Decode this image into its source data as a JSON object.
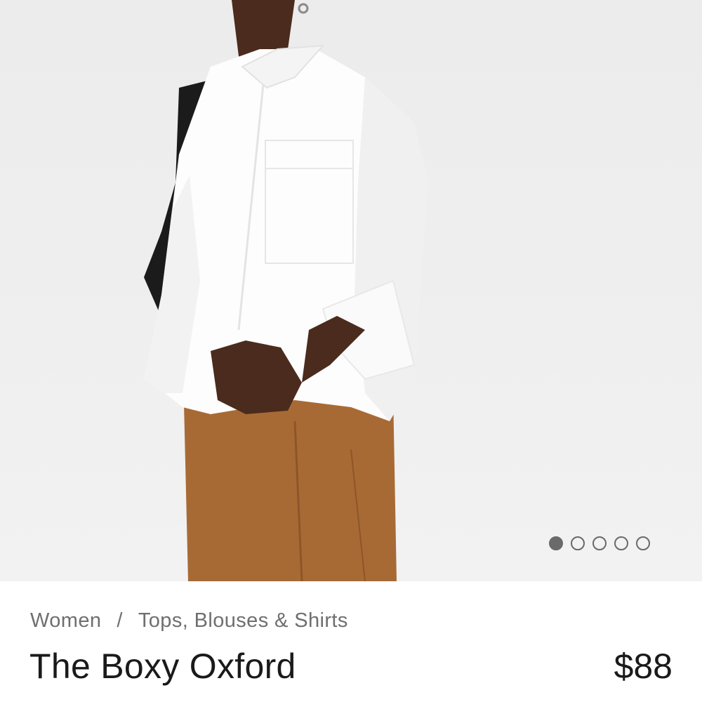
{
  "product_image": {
    "icon": "product-photo-white-boxy-oxford-shirt",
    "carousel": {
      "total": 5,
      "active_index": 0
    }
  },
  "breadcrumb": {
    "items": [
      "Women",
      "Tops, Blouses & Shirts"
    ],
    "separator": "/"
  },
  "product": {
    "title": "The Boxy Oxford",
    "price": "$88"
  },
  "colors": {
    "text_primary": "#1a1a1a",
    "text_secondary": "#6f6f6f",
    "dot": "#6a6a6a"
  }
}
